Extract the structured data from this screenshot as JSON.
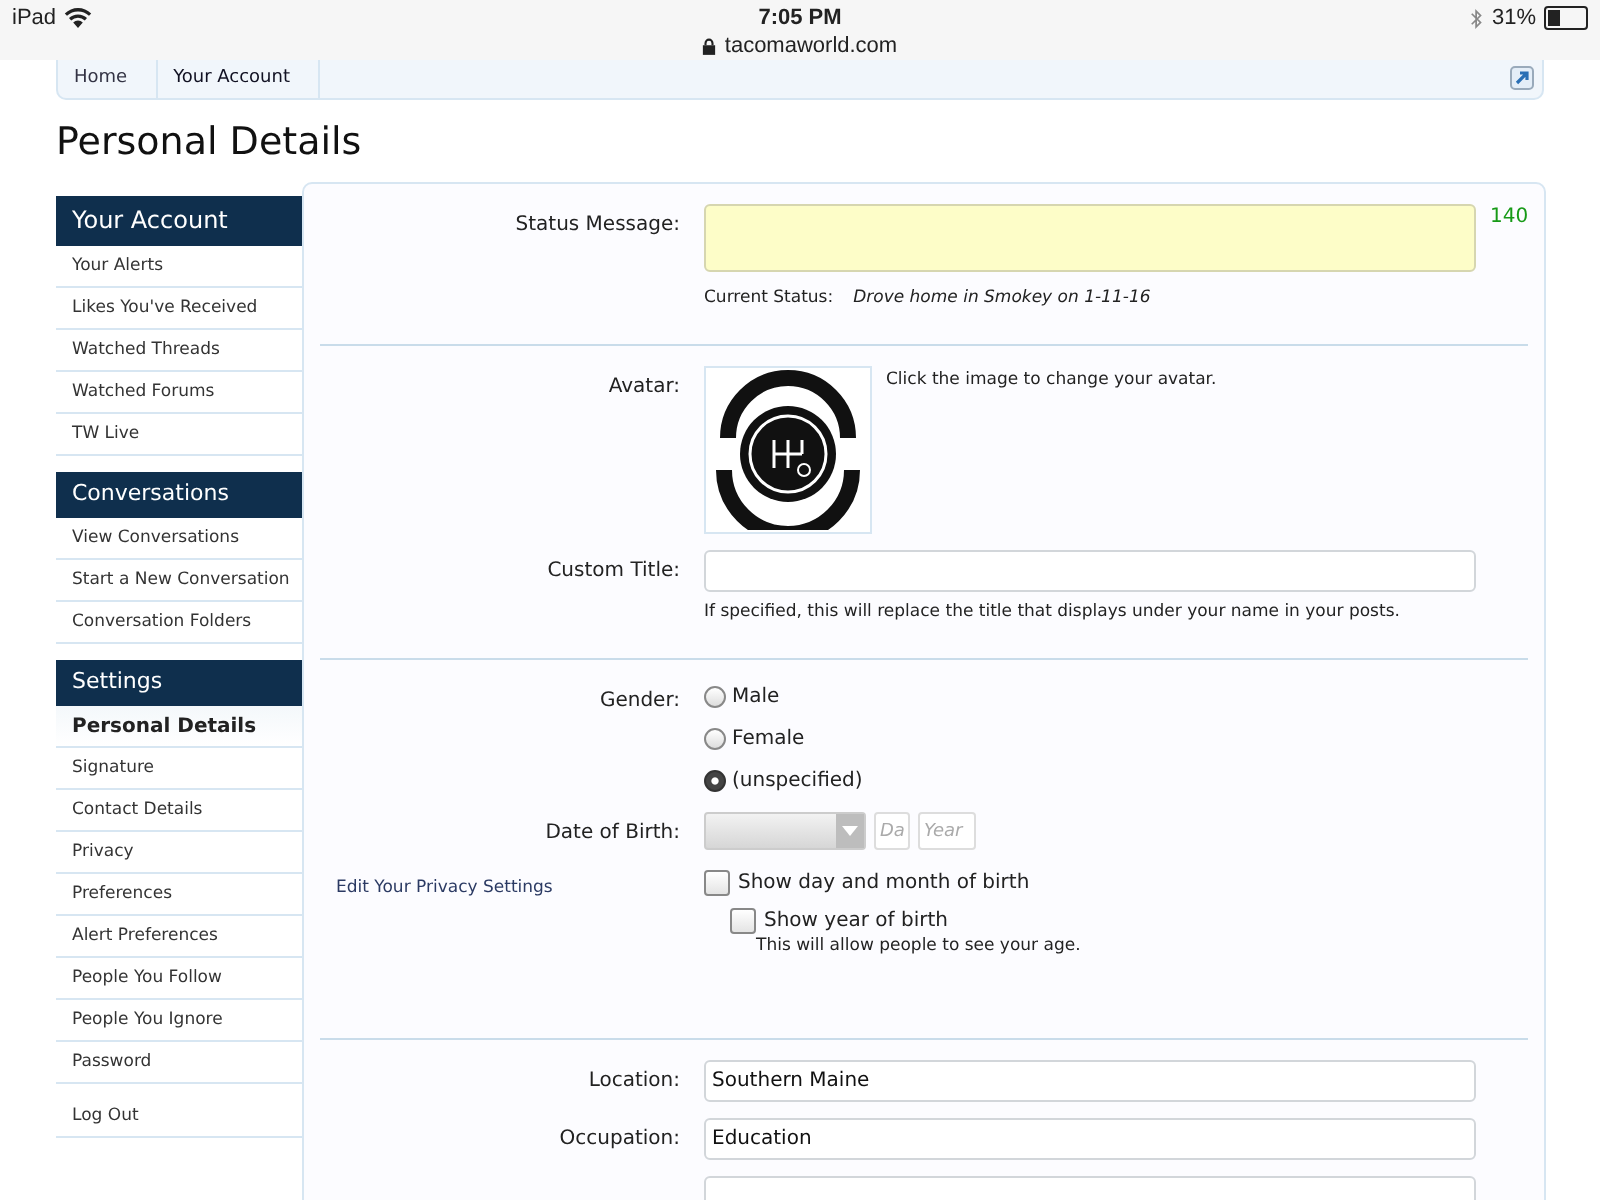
{
  "status_bar": {
    "device": "iPad",
    "time": "7:05 PM",
    "url": "tacomaworld.com",
    "battery": "31%"
  },
  "breadcrumbs": [
    {
      "label": "Home"
    },
    {
      "label": "Your Account"
    }
  ],
  "page_title": "Personal Details",
  "sidebar": {
    "sections": [
      {
        "title": "Your Account",
        "items": [
          {
            "label": "Your Alerts",
            "selected": false
          },
          {
            "label": "Likes You've Received",
            "selected": false
          },
          {
            "label": "Watched Threads",
            "selected": false
          },
          {
            "label": "Watched Forums",
            "selected": false
          },
          {
            "label": "TW Live",
            "selected": false
          }
        ]
      },
      {
        "title": "Conversations",
        "items": [
          {
            "label": "View Conversations",
            "selected": false
          },
          {
            "label": "Start a New Conversation",
            "selected": false
          },
          {
            "label": "Conversation Folders",
            "selected": false
          }
        ]
      },
      {
        "title": "Settings",
        "items": [
          {
            "label": "Personal Details",
            "selected": true
          },
          {
            "label": "Signature",
            "selected": false
          },
          {
            "label": "Contact Details",
            "selected": false
          },
          {
            "label": "Privacy",
            "selected": false
          },
          {
            "label": "Preferences",
            "selected": false
          },
          {
            "label": "Alert Preferences",
            "selected": false
          },
          {
            "label": "People You Follow",
            "selected": false
          },
          {
            "label": "People You Ignore",
            "selected": false
          },
          {
            "label": "Password",
            "selected": false
          }
        ]
      }
    ],
    "log_out": "Log Out"
  },
  "form": {
    "status_message": {
      "label": "Status Message:",
      "counter": "140",
      "current_status_label": "Current Status:",
      "current_status": "Drove home in Smokey on 1-11-16"
    },
    "avatar": {
      "label": "Avatar:",
      "hint": "Click the image to change your avatar."
    },
    "custom_title": {
      "label": "Custom Title:",
      "hint": "If specified, this will replace the title that displays under your name in your posts."
    },
    "gender": {
      "label": "Gender:",
      "options": [
        {
          "label": "Male",
          "selected": false
        },
        {
          "label": "Female",
          "selected": false
        },
        {
          "label": "(unspecified)",
          "selected": true
        }
      ]
    },
    "date_of_birth": {
      "label": "Date of Birth:",
      "day_placeholder": "Da",
      "year_placeholder": "Year"
    },
    "privacy_link": "Edit Your Privacy Settings",
    "privacy_options": [
      {
        "label": "Show day and month of birth",
        "checked": false
      },
      {
        "label": "Show year of birth",
        "checked": false,
        "hint": "This will allow people to see your age."
      }
    ],
    "location": {
      "label": "Location:",
      "value": "Southern Maine"
    },
    "occupation": {
      "label": "Occupation:",
      "value": "Education"
    }
  }
}
